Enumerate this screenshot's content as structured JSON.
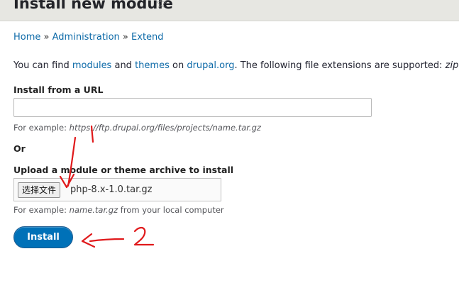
{
  "page": {
    "title": "Install new module",
    "favorite_icon": "star-outline-icon"
  },
  "breadcrumb": {
    "items": [
      "Home",
      "Administration",
      "Extend"
    ],
    "separator": "»"
  },
  "intro": {
    "text1": "You can find ",
    "modules_link": "modules",
    "text2": " and ",
    "themes_link": "themes",
    "text3": " on ",
    "drupal_link": "drupal.org",
    "text4": ". The following file extensions are supported: ",
    "extensions": "zip ta"
  },
  "url_field": {
    "label": "Install from a URL",
    "value": "",
    "desc_prefix": "For example: ",
    "desc_example": "https://ftp.drupal.org/files/projects/name.tar.gz"
  },
  "or_label": "Or",
  "upload_field": {
    "label": "Upload a module or theme archive to install",
    "button_label": "选择文件",
    "file_name": "php-8.x-1.0.tar.gz",
    "desc_prefix": "For example: ",
    "desc_example": "name.tar.gz",
    "desc_suffix": " from your local computer"
  },
  "install_button": {
    "label": "Install"
  },
  "annotations": {
    "marker_1": "1",
    "marker_2": "2",
    "color": "#e0191b"
  },
  "colors": {
    "link": "#0d6aa8",
    "primary_button": "#0071b8",
    "header_bg": "#e7e7e2"
  }
}
